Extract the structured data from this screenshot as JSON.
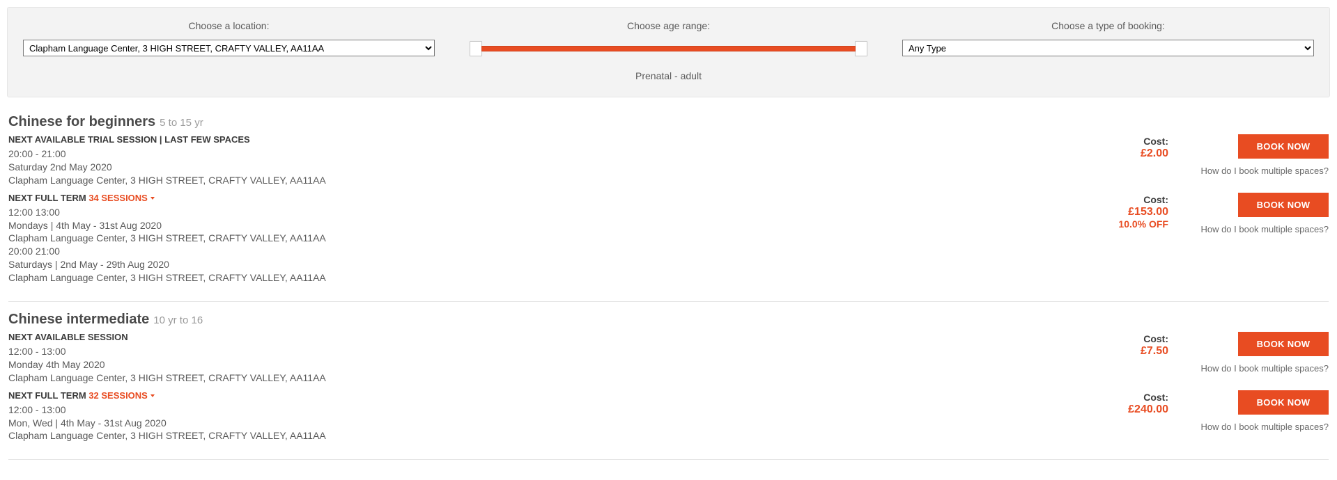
{
  "filters": {
    "location_label": "Choose a location:",
    "location_value": "Clapham Language Center, 3 HIGH STREET, CRAFTY VALLEY, AA11AA",
    "age_label": "Choose age range:",
    "age_caption": "Prenatal - adult",
    "type_label": "Choose a type of booking:",
    "type_value": "Any Type"
  },
  "common": {
    "book_label": "BOOK NOW",
    "multi_label": "How do I book multiple spaces?",
    "cost_label": "Cost:"
  },
  "classes": [
    {
      "title": "Chinese for beginners",
      "age": "5 to 15 yr",
      "sessions": [
        {
          "header_main": "NEXT AVAILABLE TRIAL SESSION | LAST FEW SPACES",
          "header_extra": "",
          "has_caret": false,
          "lines": [
            "20:00 - 21:00",
            "Saturday 2nd May 2020",
            "Clapham Language Center, 3 HIGH STREET, CRAFTY VALLEY, AA11AA"
          ],
          "cost": "£2.00",
          "discount": ""
        },
        {
          "header_main": "NEXT FULL TERM ",
          "header_extra": "34 SESSIONS",
          "has_caret": true,
          "lines": [
            "12:00 13:00",
            "Mondays | 4th May - 31st Aug 2020",
            "Clapham Language Center, 3 HIGH STREET, CRAFTY VALLEY, AA11AA",
            "20:00 21:00",
            "Saturdays | 2nd May - 29th Aug 2020",
            "Clapham Language Center, 3 HIGH STREET, CRAFTY VALLEY, AA11AA"
          ],
          "cost": "£153.00",
          "discount": "10.0% OFF"
        }
      ]
    },
    {
      "title": "Chinese intermediate",
      "age": "10 yr to 16",
      "sessions": [
        {
          "header_main": "NEXT AVAILABLE SESSION",
          "header_extra": "",
          "has_caret": false,
          "lines": [
            "12:00 - 13:00",
            "Monday 4th May 2020",
            "Clapham Language Center, 3 HIGH STREET, CRAFTY VALLEY, AA11AA"
          ],
          "cost": "£7.50",
          "discount": ""
        },
        {
          "header_main": "NEXT FULL TERM ",
          "header_extra": "32 SESSIONS",
          "has_caret": true,
          "lines": [
            "12:00 - 13:00",
            "Mon, Wed | 4th May - 31st Aug 2020",
            "Clapham Language Center, 3 HIGH STREET, CRAFTY VALLEY, AA11AA"
          ],
          "cost": "£240.00",
          "discount": ""
        }
      ]
    }
  ]
}
